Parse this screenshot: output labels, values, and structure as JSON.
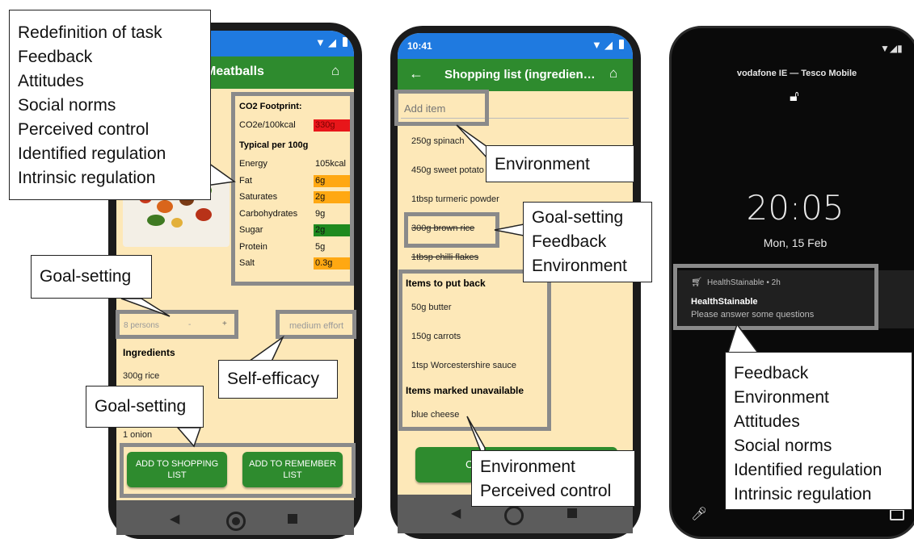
{
  "colors": {
    "appbar": "#2e8b2e",
    "cream": "#fde8b8",
    "co2": "#e8161a",
    "amber": "#ffa812",
    "green_level": "#1f8a1f",
    "highlight_box": "#8a8a8a"
  },
  "phone1": {
    "app_title": "Meatballs",
    "co2_heading": "CO2 Footprint:",
    "co2_label": "CO2e/100kcal",
    "co2_value": "330g",
    "typical_heading": "Typical per 100g",
    "nutrition": [
      {
        "label": "Energy",
        "value": "105kcal",
        "level": "none"
      },
      {
        "label": "Fat",
        "value": "6g",
        "level": "amber"
      },
      {
        "label": "Saturates",
        "value": "2g",
        "level": "amber"
      },
      {
        "label": "Carbohydrates",
        "value": "9g",
        "level": "none"
      },
      {
        "label": "Sugar",
        "value": "2g",
        "level": "green"
      },
      {
        "label": "Protein",
        "value": "5g",
        "level": "none"
      },
      {
        "label": "Salt",
        "value": "0.3g",
        "level": "amber"
      }
    ],
    "persons": "8 persons",
    "minus": "-",
    "plus": "+",
    "effort": "medium effort",
    "ingredients_heading": "Ingredients",
    "ingredients": [
      "300g rice",
      "1 onion"
    ],
    "btn_shopping": "ADD TO SHOPPING LIST",
    "btn_remember": "ADD TO REMEMBER LIST",
    "icons": [
      "wifi-icon",
      "signal-icon",
      "battery-icon",
      "home-icon",
      "back-triangle-icon",
      "home-circle-icon",
      "recents-square-icon"
    ]
  },
  "phone2": {
    "time": "10:41",
    "app_title": "Shopping list (ingredien…",
    "add_item_placeholder": "Add item",
    "items": [
      {
        "text": "250g spinach",
        "struck": false
      },
      {
        "text": "450g sweet potato",
        "struck": false
      },
      {
        "text": "1tbsp turmeric powder",
        "struck": false
      },
      {
        "text": "300g brown rice",
        "struck": true
      },
      {
        "text": "1tbsp chilli flakes",
        "struck": true
      }
    ],
    "put_back_heading": "Items to put back",
    "put_back_items": [
      "50g butter",
      "150g carrots",
      "1tsp Worcestershire sauce"
    ],
    "unavailable_heading": "Items marked unavailable",
    "unavailable_items": [
      "blue cheese"
    ],
    "bottom_button_partial": "C"
  },
  "phone3": {
    "carrier": "vodafone IE — Tesco Mobile",
    "clock": "20:05",
    "date": "Mon, 15 Feb",
    "notification_app": "HealthStainable • 2h",
    "notification_title": "HealthStainable",
    "notification_body": "Please answer some questions"
  },
  "callouts": {
    "top_left": [
      "Redefinition of task",
      "Feedback",
      "Attitudes",
      "Social norms",
      "Perceived control",
      "Identified regulation",
      "Intrinsic regulation"
    ],
    "goal_setting_1": [
      "Goal-setting"
    ],
    "self_efficacy": [
      "Self-efficacy"
    ],
    "goal_setting_2": [
      "Goal-setting"
    ],
    "environment_1": [
      "Environment"
    ],
    "goal_feedback_env": [
      "Goal-setting",
      "Feedback",
      "Environment"
    ],
    "env_perceived": [
      "Environment",
      "Perceived control"
    ],
    "right_bottom": [
      "Feedback",
      "Environment",
      "Attitudes",
      "Social norms",
      "Identified regulation",
      "Intrinsic regulation"
    ]
  }
}
